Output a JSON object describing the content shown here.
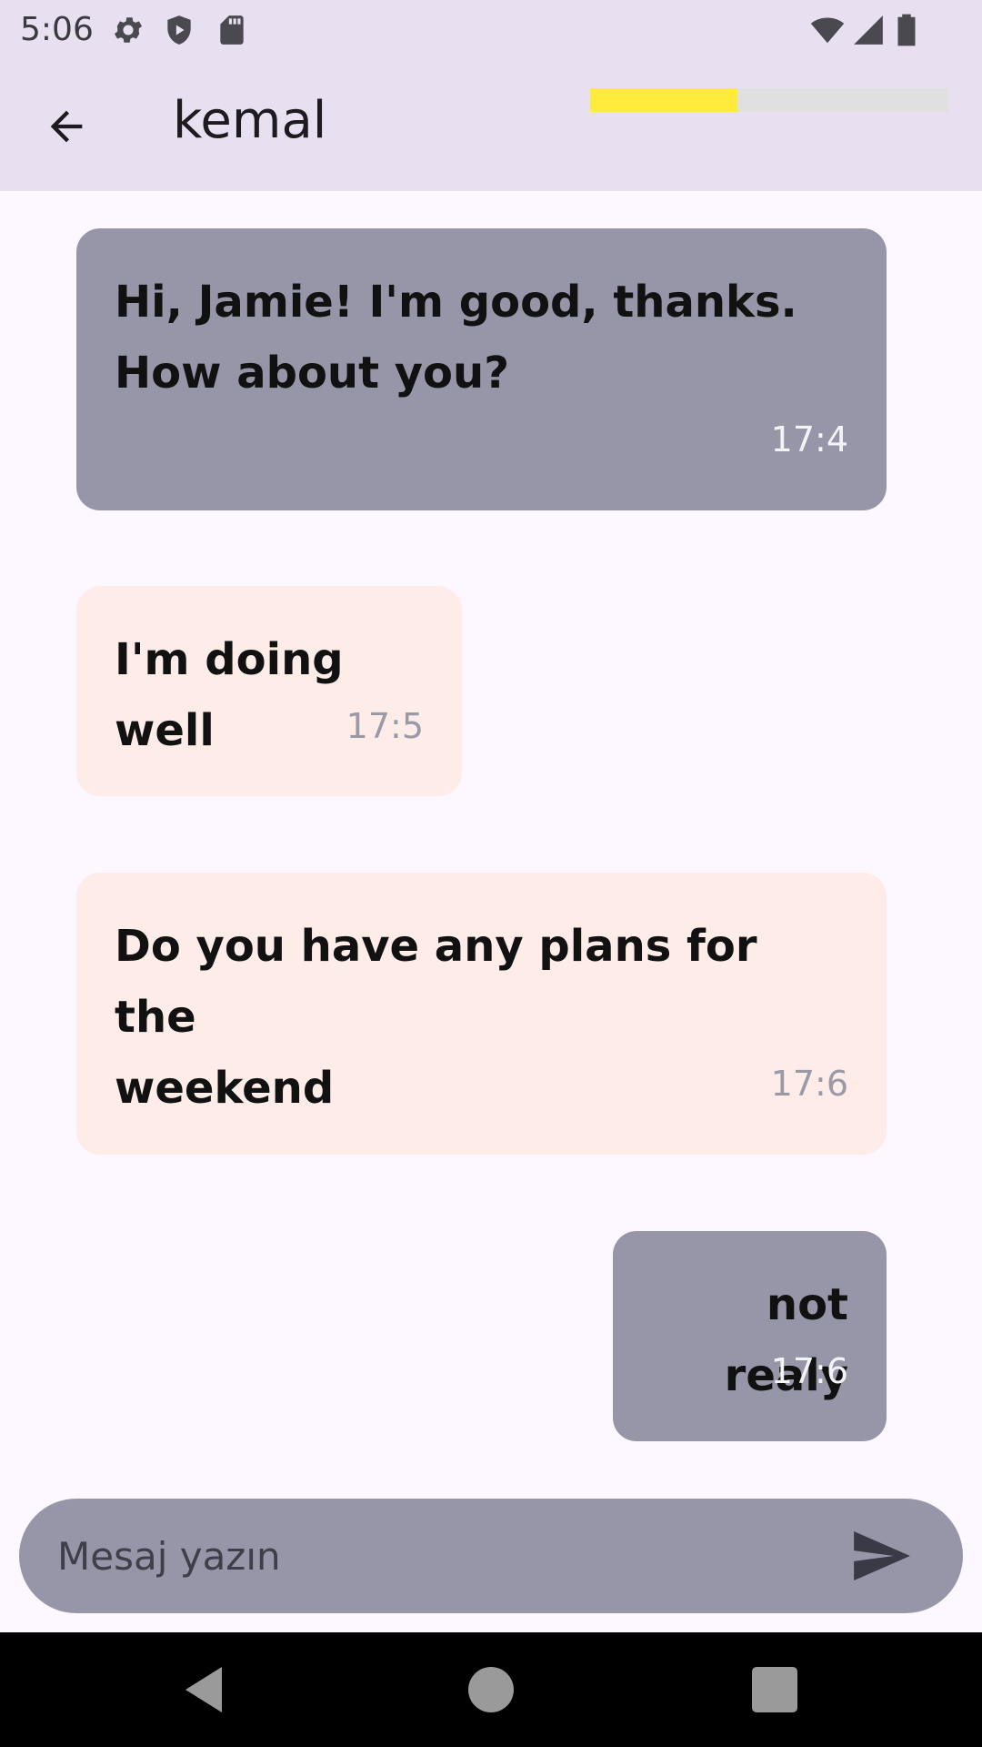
{
  "status_bar": {
    "time": "5:06",
    "icons": [
      "gear-icon",
      "shield-icon",
      "sd-card-icon",
      "wifi-icon",
      "cell-signal-icon",
      "battery-icon"
    ]
  },
  "app_bar": {
    "back_icon": "arrow-left-icon",
    "title": "kemal",
    "progress_fraction": 0.41,
    "progress_color": "#FFEB3B",
    "progress_track_color": "#E0E0E0"
  },
  "messages": [
    {
      "text_line1": "Hi, Jamie! I'm good, thanks.",
      "text_line2": "How about you?",
      "time": "17:4",
      "style": "gray"
    },
    {
      "text_line1": "I'm doing well",
      "time": "17:5",
      "style": "pink"
    },
    {
      "text_line1": "Do you have any plans for the",
      "text_line2": "weekend",
      "time": "17:6",
      "style": "pink"
    },
    {
      "text_line1": "not realy",
      "time": "17:6",
      "style": "gray"
    }
  ],
  "composer": {
    "placeholder": "Mesaj yazın",
    "value": "",
    "send_icon": "send-icon"
  },
  "nav_bar": {
    "icons": [
      "nav-back-icon",
      "nav-home-icon",
      "nav-recents-icon"
    ]
  },
  "colors": {
    "appbar_bg": "#E8E0F0",
    "page_bg": "#FDF7FF",
    "bubble_gray": "#9696A8",
    "bubble_pink": "#FDECE8"
  }
}
